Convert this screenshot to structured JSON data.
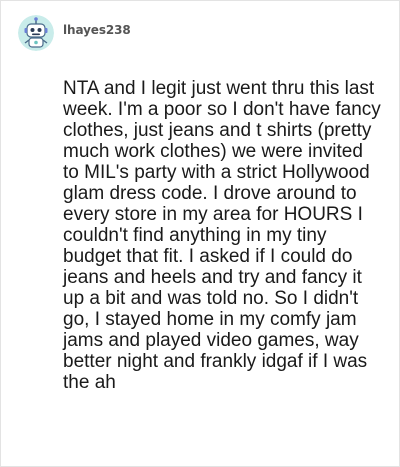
{
  "post": {
    "username": "lhayes238",
    "avatar_icon": "robot-avatar-icon",
    "text": "NTA and I legit just went thru this last week. I'm a poor so I don't have fancy clothes, just jeans and t shirts (pretty much work clothes) we were invited to MIL's party with a strict Hollywood glam dress code. I drove around to every store in my area for HOURS I couldn't find anything in my tiny budget that fit. I asked if I could do jeans and heels and try and fancy it up a bit and was told no. So I didn't go, I stayed home in my comfy jam jams and played video games, way better night and frankly idgaf if I was the ah"
  },
  "colors": {
    "avatar_bg": "#c9ecea",
    "username": "#555555",
    "text": "#1a1a1a",
    "border": "#e3e3e3"
  }
}
